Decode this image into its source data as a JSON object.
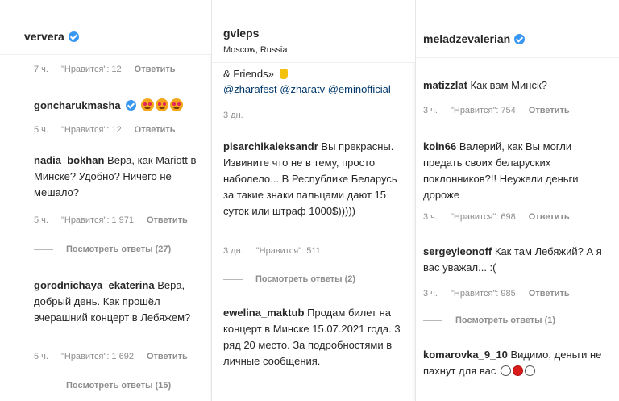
{
  "panel1": {
    "header": {
      "username": "ververa"
    },
    "top_meta": {
      "time": "7 ч.",
      "likes": "\"Нравится\": 12",
      "reply": "Ответить"
    },
    "comments": [
      {
        "user": "goncharukmasha",
        "text": "",
        "time": "5 ч.",
        "likes": "\"Нравится\": 12",
        "reply": "Ответить"
      },
      {
        "user": "nadia_bokhan",
        "text": "Вера, как Mariott в Минске? Удобно? Ничего не мешало?",
        "time": "5 ч.",
        "likes": "\"Нравится\": 1 971",
        "reply": "Ответить",
        "view_replies": "Посмотреть ответы (27)"
      },
      {
        "user": "gorodnichaya_ekaterina",
        "text": "Вера, добрый день. Как прошёл вчерашний концерт в Лебяжем?",
        "time": "5 ч.",
        "likes": "\"Нравится\": 1 692",
        "reply": "Ответить",
        "view_replies": "Посмотреть ответы (15)"
      }
    ]
  },
  "panel2": {
    "header": {
      "username": "gvleps",
      "location": "Moscow, Russia"
    },
    "caption_tail": {
      "line1": "& Friends»",
      "mentions": "@zharafest @zharatv @eminofficial",
      "time": "3 дн."
    },
    "comments": [
      {
        "user": "pisarchikaleksandr",
        "text": "Вы прекрасны. Извините что не в тему, просто наболело... В Республике Беларусь за такие знаки пальцами дают 15 суток или штраф 1000$)))))",
        "time": "3 дн.",
        "likes": "\"Нравится\": 511",
        "view_replies": "Посмотреть ответы (2)"
      },
      {
        "user": "ewelina_maktub",
        "text": "Продам билет на концерт в Минске 15.07.2021 года. 3 ряд 20 место. За подробностями в личные сообщения."
      }
    ]
  },
  "panel3": {
    "header": {
      "username": "meladzevalerian"
    },
    "comments": [
      {
        "user": "matizzlat",
        "text": "Как вам Минск?",
        "time": "3 ч.",
        "likes": "\"Нравится\": 754",
        "reply": "Ответить"
      },
      {
        "user": "koin66",
        "text": "Валерий, как Вы могли предать своих беларуских поклонников?!! Неужели деньги дороже",
        "time": "3 ч.",
        "likes": "\"Нравится\": 698",
        "reply": "Ответить"
      },
      {
        "user": "sergeyleonoff",
        "text": "Как там Лебяжий? А я вас уважал... :(",
        "time": "3 ч.",
        "likes": "\"Нравится\": 985",
        "reply": "Ответить",
        "view_replies": "Посмотреть ответы (1)"
      },
      {
        "user": "komarovka_9_10",
        "text": "Видимо, деньги не пахнут для вас"
      }
    ]
  },
  "colors": {
    "verified": "#3897f0",
    "meta": "#8e8e8e",
    "mention": "#00376b"
  }
}
